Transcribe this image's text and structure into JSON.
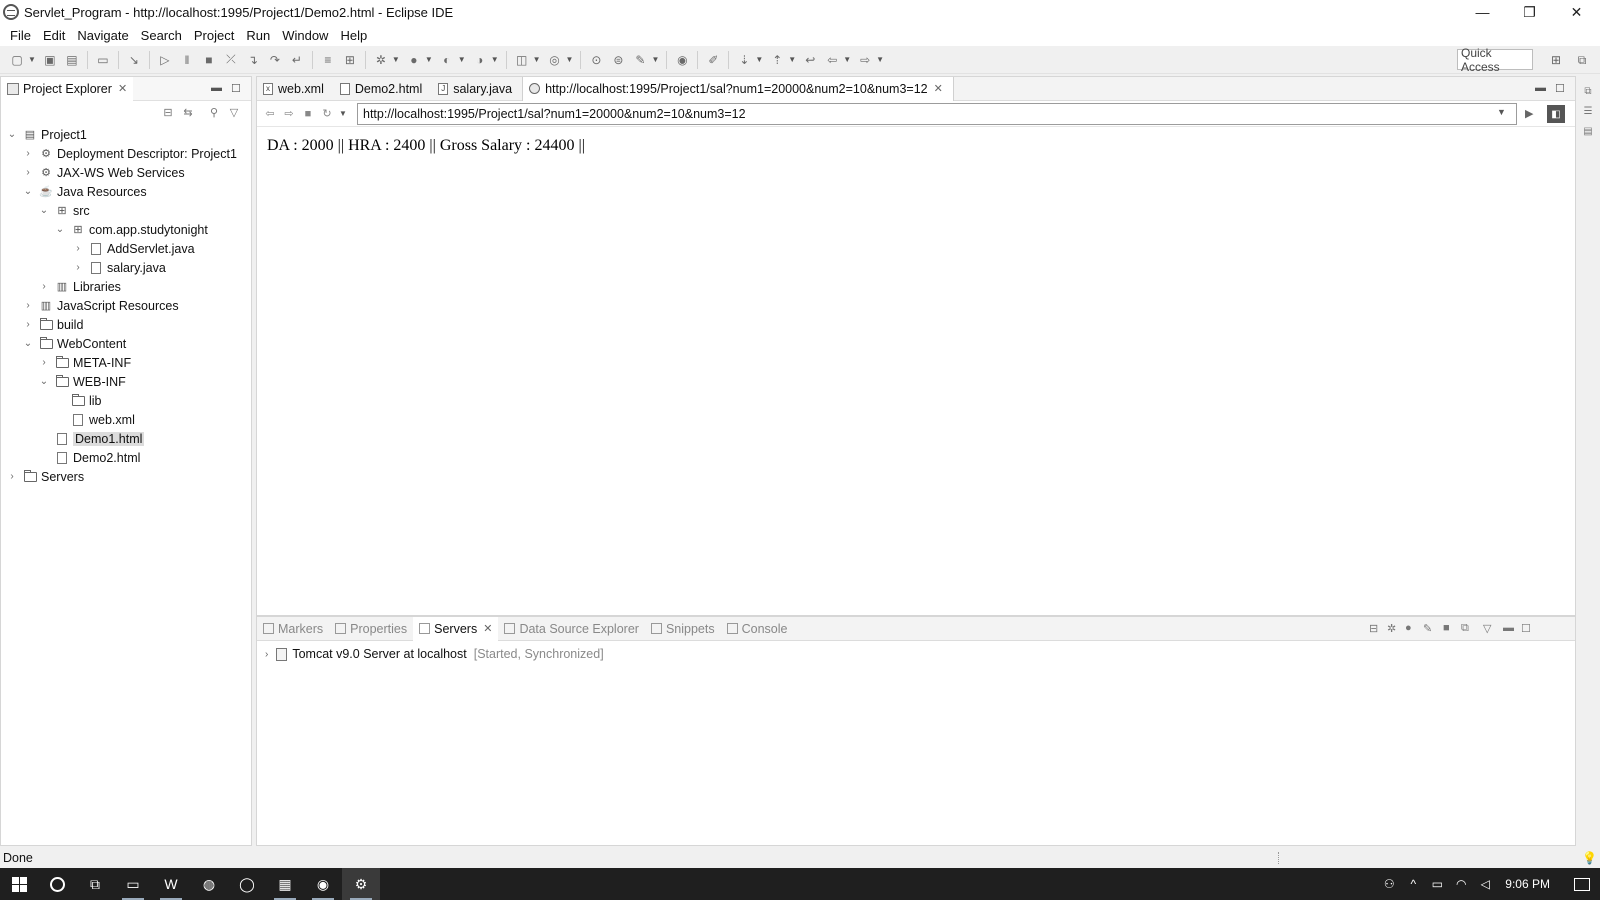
{
  "window": {
    "title": "Servlet_Program - http://localhost:1995/Project1/Demo2.html - Eclipse IDE",
    "controls": {
      "minimize": "—",
      "restore": "❐",
      "close": "✕"
    }
  },
  "menu": [
    "File",
    "Edit",
    "Navigate",
    "Search",
    "Project",
    "Run",
    "Window",
    "Help"
  ],
  "toolbar": {
    "quick_access": "Quick Access"
  },
  "project_explorer": {
    "tab_label": "Project Explorer",
    "tree": [
      {
        "label": "Project1",
        "level": 0,
        "expanded": true,
        "icon": "project-icon"
      },
      {
        "label": "Deployment Descriptor: Project1",
        "level": 1,
        "expanded": false,
        "icon": "descriptor-icon"
      },
      {
        "label": "JAX-WS Web Services",
        "level": 1,
        "expanded": false,
        "icon": "webservice-icon"
      },
      {
        "label": "Java Resources",
        "level": 1,
        "expanded": true,
        "icon": "java-resources-icon"
      },
      {
        "label": "src",
        "level": 2,
        "expanded": true,
        "icon": "source-folder-icon"
      },
      {
        "label": "com.app.studytonight",
        "level": 3,
        "expanded": true,
        "icon": "package-icon"
      },
      {
        "label": "AddServlet.java",
        "level": 4,
        "expanded": false,
        "icon": "java-file-icon"
      },
      {
        "label": "salary.java",
        "level": 4,
        "expanded": false,
        "icon": "java-file-icon"
      },
      {
        "label": "Libraries",
        "level": 2,
        "expanded": false,
        "icon": "library-icon"
      },
      {
        "label": "JavaScript Resources",
        "level": 1,
        "expanded": false,
        "icon": "js-resources-icon"
      },
      {
        "label": "build",
        "level": 1,
        "expanded": false,
        "icon": "folder-icon"
      },
      {
        "label": "WebContent",
        "level": 1,
        "expanded": true,
        "icon": "folder-icon"
      },
      {
        "label": "META-INF",
        "level": 2,
        "expanded": false,
        "icon": "folder-icon"
      },
      {
        "label": "WEB-INF",
        "level": 2,
        "expanded": true,
        "icon": "folder-icon"
      },
      {
        "label": "lib",
        "level": 3,
        "leaf": true,
        "icon": "folder-icon"
      },
      {
        "label": "web.xml",
        "level": 3,
        "leaf": true,
        "icon": "xml-file-icon"
      },
      {
        "label": "Demo1.html",
        "level": 2,
        "leaf": true,
        "selected": true,
        "icon": "html-file-icon"
      },
      {
        "label": "Demo2.html",
        "level": 2,
        "leaf": true,
        "icon": "html-file-icon"
      },
      {
        "label": "Servers",
        "level": 0,
        "expanded": false,
        "icon": "folder-icon"
      }
    ]
  },
  "editor": {
    "tabs": [
      {
        "label": "web.xml",
        "icon": "xml-file-icon",
        "badge": "x"
      },
      {
        "label": "Demo2.html",
        "icon": "html-file-icon",
        "badge": ""
      },
      {
        "label": "salary.java",
        "icon": "java-file-icon",
        "badge": "J"
      },
      {
        "label": "http://localhost:1995/Project1/sal?num1=20000&num2=10&num3=12",
        "icon": "globe-icon",
        "active": true
      }
    ],
    "url": "http://localhost:1995/Project1/sal?num1=20000&num2=10&num3=12",
    "page_output": "DA : 2000 || HRA : 2400 || Gross Salary : 24400 ||"
  },
  "bottom_panel": {
    "tabs": [
      {
        "label": "Markers",
        "active": false
      },
      {
        "label": "Properties",
        "active": false
      },
      {
        "label": "Servers",
        "active": true
      },
      {
        "label": "Data Source Explorer",
        "active": false
      },
      {
        "label": "Snippets",
        "active": false
      },
      {
        "label": "Console",
        "active": false
      }
    ],
    "server": {
      "name": "Tomcat v9.0 Server at localhost",
      "status": "[Started, Synchronized]"
    }
  },
  "status": {
    "text": "Done"
  },
  "taskbar": {
    "time": "9:06 PM"
  }
}
